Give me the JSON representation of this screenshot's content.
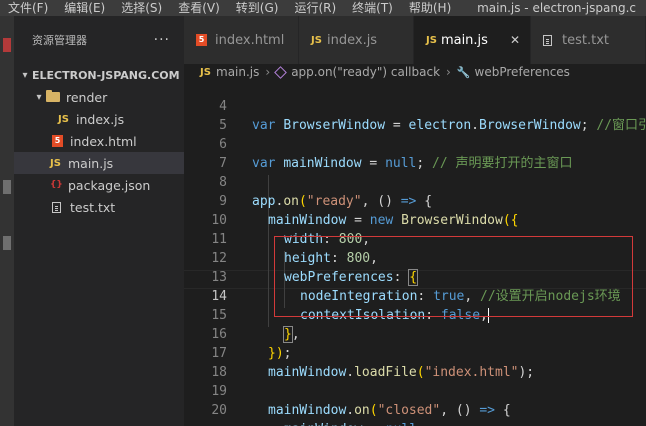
{
  "menu": [
    "文件(F)",
    "编辑(E)",
    "选择(S)",
    "查看(V)",
    "转到(G)",
    "运行(R)",
    "终端(T)",
    "帮助(H)"
  ],
  "window_title": "main.js - electron-jspang.c",
  "sidebar": {
    "title": "资源管理器",
    "more": "···",
    "project": "ELECTRON-JSPANG.COM",
    "items": [
      {
        "label": "render",
        "icon": "folder-icon"
      },
      {
        "label": "index.js",
        "icon": "js-icon"
      },
      {
        "label": "index.html",
        "icon": "html-icon"
      },
      {
        "label": "main.js",
        "icon": "js-icon"
      },
      {
        "label": "package.json",
        "icon": "json-icon"
      },
      {
        "label": "test.txt",
        "icon": "txt-icon"
      }
    ]
  },
  "tabs": [
    {
      "label": "index.html",
      "icon": "html-icon"
    },
    {
      "label": "index.js",
      "icon": "js-icon"
    },
    {
      "label": "main.js",
      "icon": "js-icon",
      "active": true,
      "close": "✕"
    },
    {
      "label": "test.txt",
      "icon": "txt-icon"
    }
  ],
  "breadcrumb": [
    "main.js",
    "app.on(\"ready\") callback",
    "webPreferences"
  ],
  "icons": {
    "js": "JS",
    "html": "5",
    "json": "{}"
  },
  "line_numbers": [
    "4",
    "5",
    "6",
    "7",
    "8",
    "9",
    "10",
    "11",
    "12",
    "13",
    "14",
    "15",
    "16",
    "17",
    "18",
    "19",
    "20"
  ],
  "active_line": "14",
  "code": {
    "l4_a": "var ",
    "l4_b": "BrowserWindow",
    "l4_c": " = ",
    "l4_d": "electron",
    "l4_e": ".",
    "l4_f": "BrowserWindow",
    "l4_g": "; ",
    "l4_h": "//窗口引",
    "l6_a": "var ",
    "l6_b": "mainWindow",
    "l6_c": " = ",
    "l6_d": "null",
    "l6_e": "; ",
    "l6_f": "// 声明要打开的主窗口",
    "l8_a": "app",
    "l8_b": ".",
    "l8_c": "on",
    "l8_d": "(",
    "l8_e": "\"ready\"",
    "l8_f": ", () ",
    "l8_g": "=>",
    "l8_h": " {",
    "l9_a": "mainWindow",
    "l9_b": " = ",
    "l9_c": "new ",
    "l9_d": "BrowserWindow",
    "l9_e": "({",
    "l10_a": "width",
    "l10_b": ": ",
    "l10_c": "800",
    "l10_d": ",",
    "l11_a": "height",
    "l11_b": ": ",
    "l11_c": "800",
    "l11_d": ",",
    "l12_a": "webPreferences",
    "l12_b": ": ",
    "l12_c": "{",
    "l13_a": "nodeIntegration",
    "l13_b": ": ",
    "l13_c": "true",
    "l13_d": ", ",
    "l13_e": "//设置开启nodejs环境",
    "l14_a": "contextIsolation",
    "l14_b": ": ",
    "l14_c": "false",
    "l14_d": ",",
    "l15_a": "}",
    "l15_b": ",",
    "l16_a": "})",
    "l16_b": ";",
    "l17_a": "mainWindow",
    "l17_b": ".",
    "l17_c": "loadFile",
    "l17_d": "(",
    "l17_e": "\"index.html\"",
    "l17_f": ");",
    "l19_a": "mainWindow",
    "l19_b": ".",
    "l19_c": "on",
    "l19_d": "(",
    "l19_e": "\"closed\"",
    "l19_f": ", () ",
    "l19_g": "=>",
    "l19_h": " {",
    "l20_a": "mainWindow",
    "l20_b": " = ",
    "l20_c": "null",
    "l20_d": ";"
  },
  "colors": {
    "highlight_box": "#d33a3a",
    "accent": "#007acc"
  }
}
